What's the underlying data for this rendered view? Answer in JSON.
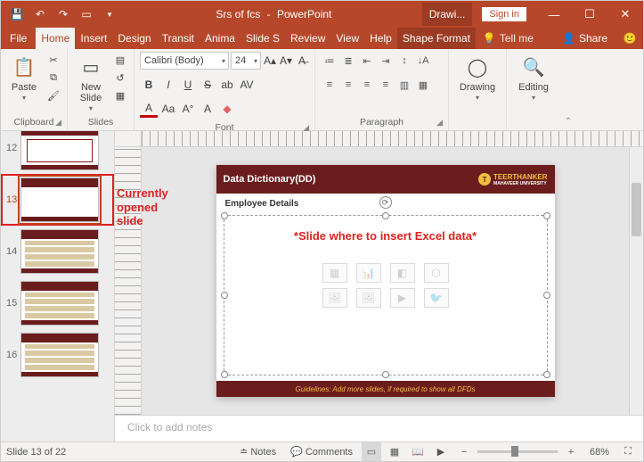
{
  "titlebar": {
    "doc_title": "Srs of fcs",
    "app_name": "PowerPoint",
    "drawing_label": "Drawi...",
    "signin": "Sign in"
  },
  "tabs": {
    "file": "File",
    "home": "Home",
    "insert": "Insert",
    "design": "Design",
    "transitions": "Transit",
    "animations": "Anima",
    "slideshow": "Slide S",
    "review": "Review",
    "view": "View",
    "help": "Help",
    "shape_format": "Shape Format",
    "tell_me": "Tell me",
    "share": "Share"
  },
  "ribbon": {
    "clipboard": {
      "label": "Clipboard",
      "paste": "Paste"
    },
    "slides": {
      "label": "Slides",
      "new_slide": "New\nSlide"
    },
    "font": {
      "label": "Font",
      "name": "Calibri (Body)",
      "size": "24"
    },
    "paragraph": {
      "label": "Paragraph"
    },
    "drawing": {
      "label": "Drawing",
      "btn": "Drawing"
    },
    "editing": {
      "label": "Editing",
      "btn": "Editing"
    }
  },
  "thumbnails": [
    {
      "num": "12"
    },
    {
      "num": "13",
      "selected": true
    },
    {
      "num": "14"
    },
    {
      "num": "15"
    },
    {
      "num": "16"
    }
  ],
  "annotation": "Currently\nopened\nslide",
  "slide": {
    "title": "Data Dictionary(DD)",
    "logo_main": "TEERTHANKER",
    "logo_sub": "MAHAVEER UNIVERSITY",
    "subheading": "Employee Details",
    "callout": "*Slide where to insert Excel data*",
    "footer": "Guidelines: Add more slides, if required to show all DFDs"
  },
  "notes_placeholder": "Click to add notes",
  "status": {
    "slide_of": "Slide 13 of 22",
    "notes": "Notes",
    "comments": "Comments",
    "zoom": "68%"
  }
}
